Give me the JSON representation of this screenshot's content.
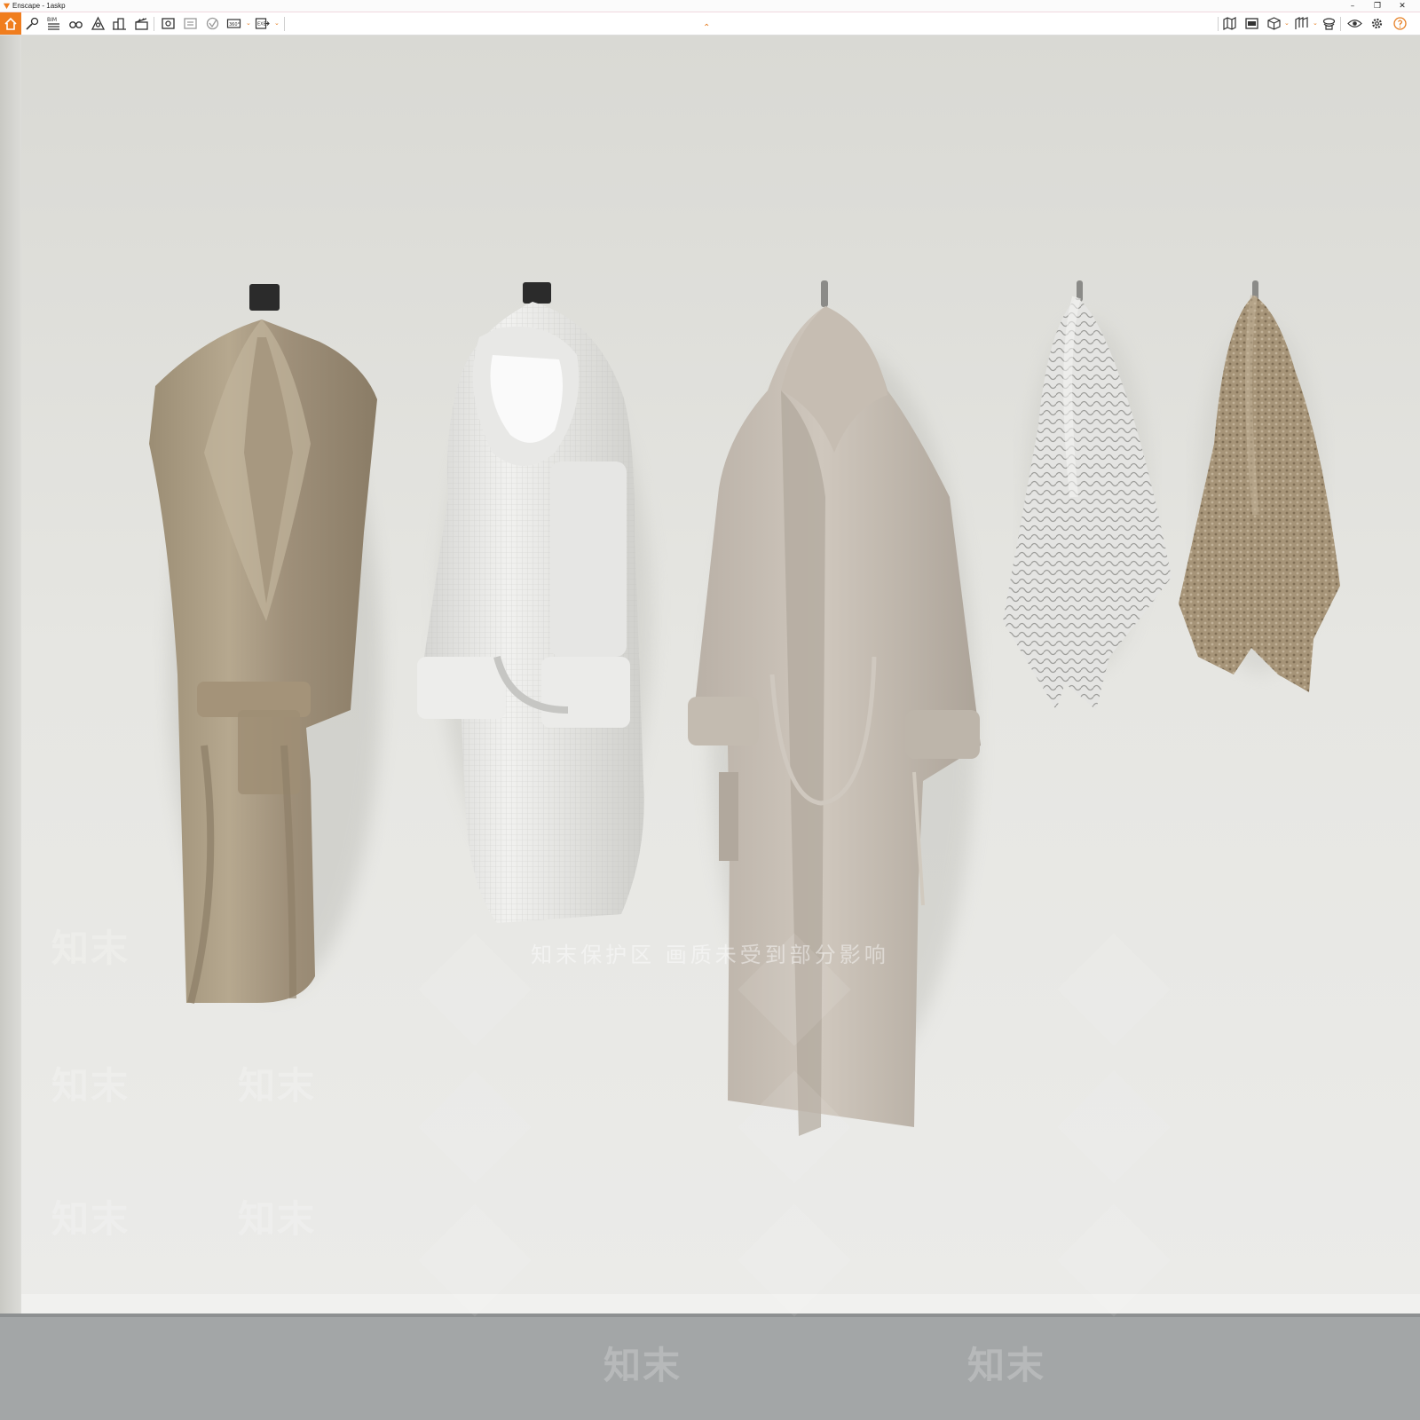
{
  "window": {
    "title": "Enscape - 1askp",
    "minimize": "–",
    "restore": "❐",
    "close": "✕"
  },
  "toolbar": {
    "left_icons": [
      "home-icon",
      "asset-library-icon",
      "bim-icon",
      "binoculars-icon",
      "visual-settings-icon",
      "buildings-icon",
      "video-editor-icon",
      "screenshot-icon",
      "batch-render-icon",
      "web-standalone-icon",
      "panorama-360-icon",
      "export-exe-icon"
    ],
    "bim_label": "BIM",
    "pano_label": "360°",
    "exe_label": "EXE",
    "right_icons": [
      "map-icon",
      "views-icon",
      "cube-icon",
      "material-editor-icon",
      "upload-icon",
      "eye-settings-icon",
      "gear-icon",
      "help-icon"
    ]
  },
  "colors": {
    "accent": "#f07d1e",
    "wall": "#e8e8e4",
    "floor": "#9ea1a2"
  },
  "watermark": {
    "brand": "知末",
    "banner": "知末保护区  画质未受到部分影响"
  },
  "scene": {
    "items": [
      "brown-robe",
      "white-waffle-robe",
      "beige-hooded-robe",
      "white-towel",
      "brown-towel"
    ]
  }
}
